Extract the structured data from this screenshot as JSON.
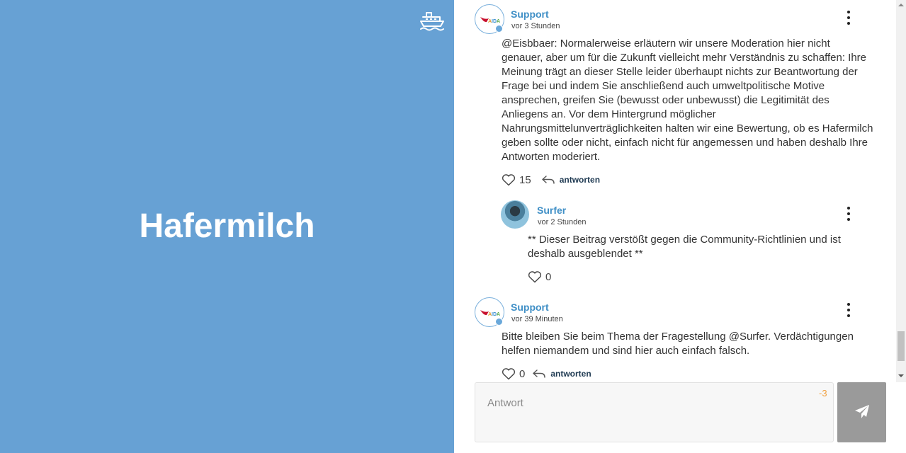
{
  "topic": {
    "title": "Hafermilch",
    "icon": "ship-icon"
  },
  "colors": {
    "left_panel_bg": "#67a1d4",
    "author_name": "#3f8fc6",
    "send_button": "#9a9a9a",
    "counter": "#f0a040"
  },
  "comments": [
    {
      "author": "Support",
      "avatar": "aida-logo-avatar",
      "verified": true,
      "time": "vor 3 Stunden",
      "text": "@Eisbbaer: Normalerweise erläutern wir unsere Moderation hier nicht genauer, aber um für die Zukunft vielleicht mehr Verständnis zu schaffen: Ihre Meinung trägt an dieser Stelle leider überhaupt nichts zur Beantwortung der Frage bei und indem Sie anschließend auch umweltpolitische Motive ansprechen, greifen Sie (bewusst oder unbewusst) die Legitimität des Anliegens an. Vor dem Hintergrund möglicher Nahrungsmittelunverträglichkeiten halten wir eine Bewertung, ob es Hafermilch geben sollte oder nicht, einfach nicht für angemessen und haben deshalb Ihre Antworten moderiert.",
      "likes": "15",
      "reply_label": "antworten"
    },
    {
      "author": "Surfer",
      "avatar": "surfer-photo-avatar",
      "verified": false,
      "time": "vor 2 Stunden",
      "text": "** Dieser Beitrag verstößt gegen die Community-Richtlinien und ist deshalb ausgeblendet **",
      "likes": "0"
    },
    {
      "author": "Support",
      "avatar": "aida-logo-avatar",
      "verified": true,
      "time": "vor 39 Minuten",
      "text": "Bitte bleiben Sie beim Thema der Fragestellung @Surfer. Verdächtigungen helfen niemandem und sind hier auch einfach falsch.",
      "likes": "0",
      "reply_label": "antworten"
    }
  ],
  "composer": {
    "placeholder": "Antwort",
    "value": "",
    "counter": "-3",
    "send_icon": "paper-plane-icon"
  }
}
